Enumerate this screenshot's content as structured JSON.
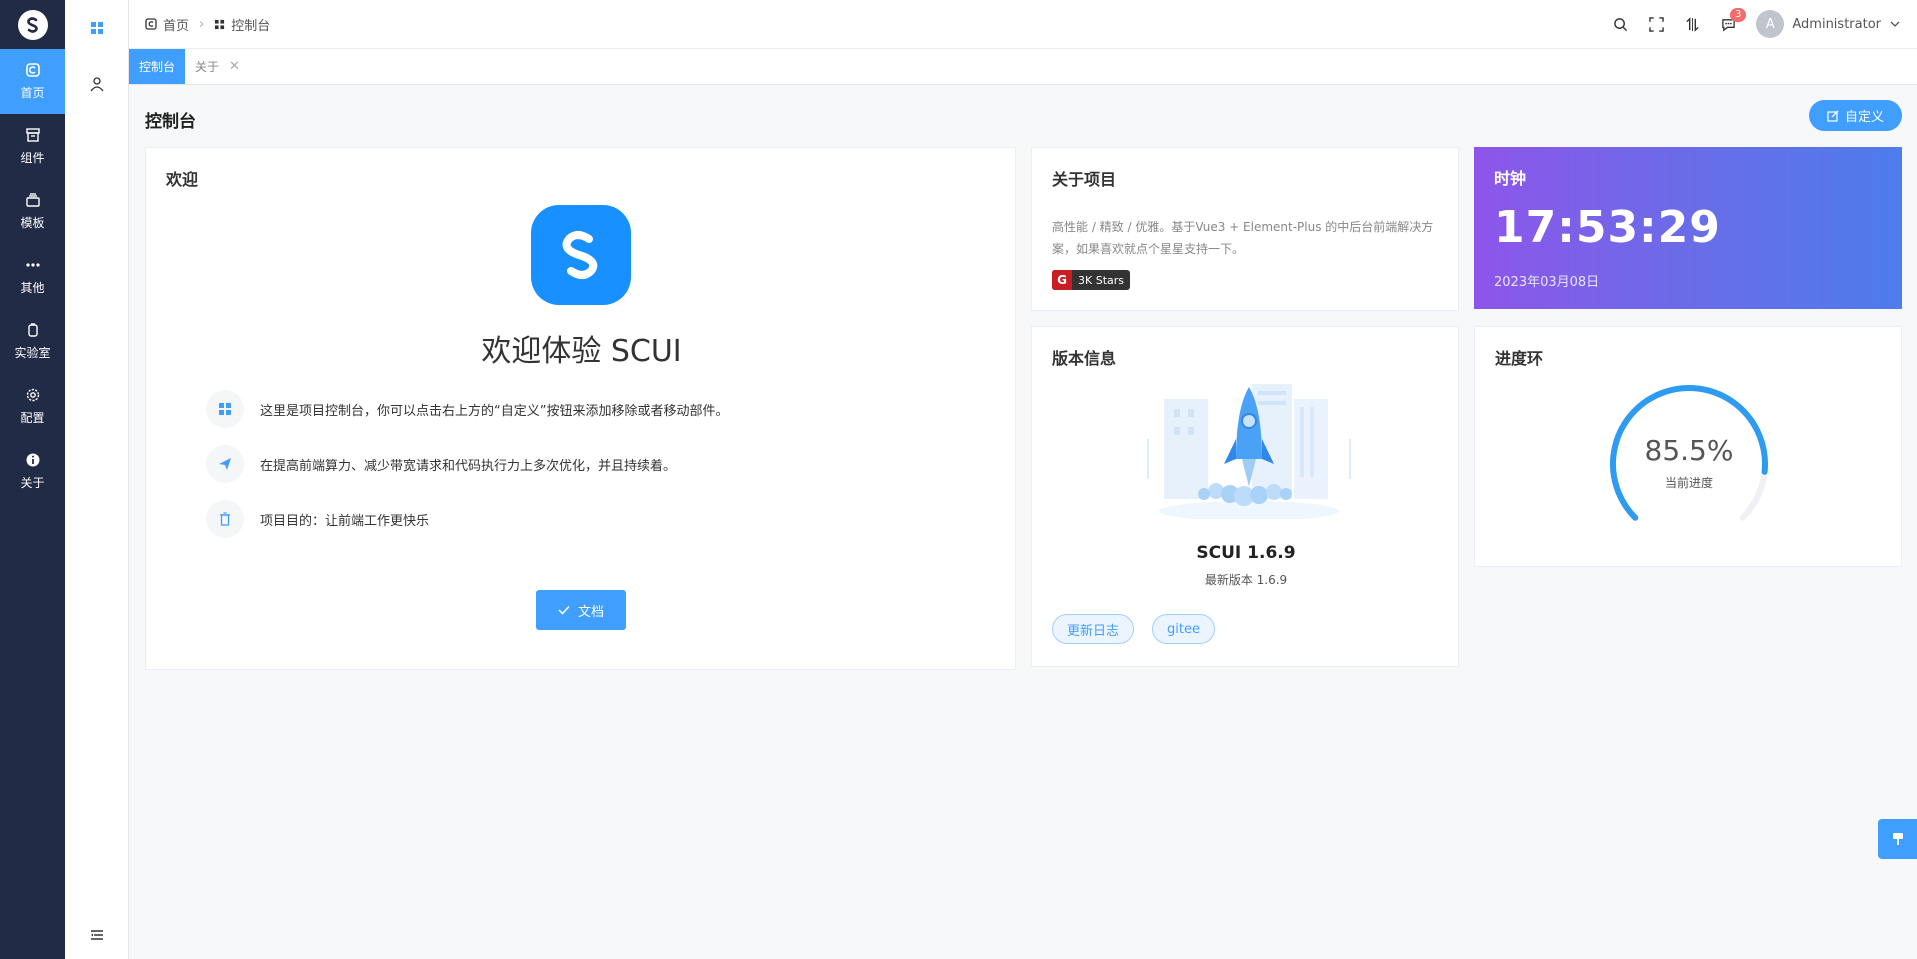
{
  "rail": {
    "items": [
      {
        "label": "首页",
        "icon": "home-icon"
      },
      {
        "label": "组件",
        "icon": "box-icon"
      },
      {
        "label": "模板",
        "icon": "template-icon"
      },
      {
        "label": "其他",
        "icon": "more-icon"
      },
      {
        "label": "实验室",
        "icon": "lab-icon"
      },
      {
        "label": "配置",
        "icon": "gear-icon"
      },
      {
        "label": "关于",
        "icon": "info-icon"
      }
    ]
  },
  "breadcrumb": {
    "home": "首页",
    "current": "控制台"
  },
  "header": {
    "notification_count": "3",
    "user_initial": "A",
    "user_name": "Administrator"
  },
  "tabs": [
    {
      "label": "控制台",
      "active": true
    },
    {
      "label": "关于",
      "active": false
    }
  ],
  "page": {
    "title": "控制台",
    "customize_label": "自定义"
  },
  "welcome": {
    "title": "欢迎",
    "headline": "欢迎体验 SCUI",
    "rows": [
      "这里是项目控制台，你可以点击右上方的“自定义”按钮来添加移除或者移动部件。",
      "在提高前端算力、减少带宽请求和代码执行力上多次优化，并且持续着。",
      "项目目的：让前端工作更快乐"
    ],
    "doc_button": "文档"
  },
  "about": {
    "title": "关于项目",
    "description": "高性能 / 精致 / 优雅。基于Vue3 + Element-Plus 的中后台前端解决方案，如果喜欢就点个星星支持一下。",
    "stars_logo": "G",
    "stars_label": "3K Stars"
  },
  "clock": {
    "title": "时钟",
    "time": "17:53:29",
    "date": "2023年03月08日"
  },
  "version": {
    "title": "版本信息",
    "version": "SCUI 1.6.9",
    "latest": "最新版本 1.6.9",
    "changelog": "更新日志",
    "gitee": "gitee"
  },
  "progress": {
    "title": "进度环",
    "percent_text": "85.5%",
    "value": 85.5,
    "label": "当前进度"
  },
  "colors": {
    "primary": "#409eff",
    "rail": "#222b45"
  }
}
